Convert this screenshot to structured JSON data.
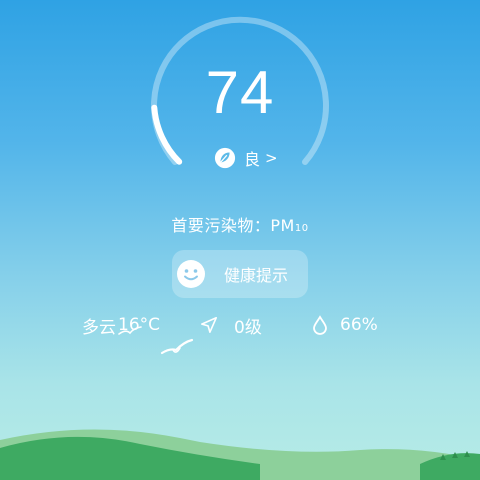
{
  "aqi": {
    "value": "74",
    "level": "良",
    "chevron": ">",
    "icon": "leaf-icon",
    "progress": 0.15
  },
  "pollutant": {
    "label": "首要污染物：PM",
    "subscript": "10"
  },
  "health_tip": {
    "label": "健康提示",
    "icon": "smile-icon"
  },
  "weather": {
    "condition": "多云",
    "temperature": "16°C",
    "wind": "0级",
    "wind_icon": "navigation-arrow-icon",
    "humidity": "66%",
    "humidity_icon": "water-drop-icon"
  },
  "colors": {
    "sky_top": "#2fa2e4",
    "sky_bottom": "#b7ece6",
    "gauge_track": "rgba(255,255,255,0.35)",
    "gauge_fill": "#ffffff",
    "hill_dark": "#3eaa62",
    "hill_light": "#8dd09b"
  }
}
